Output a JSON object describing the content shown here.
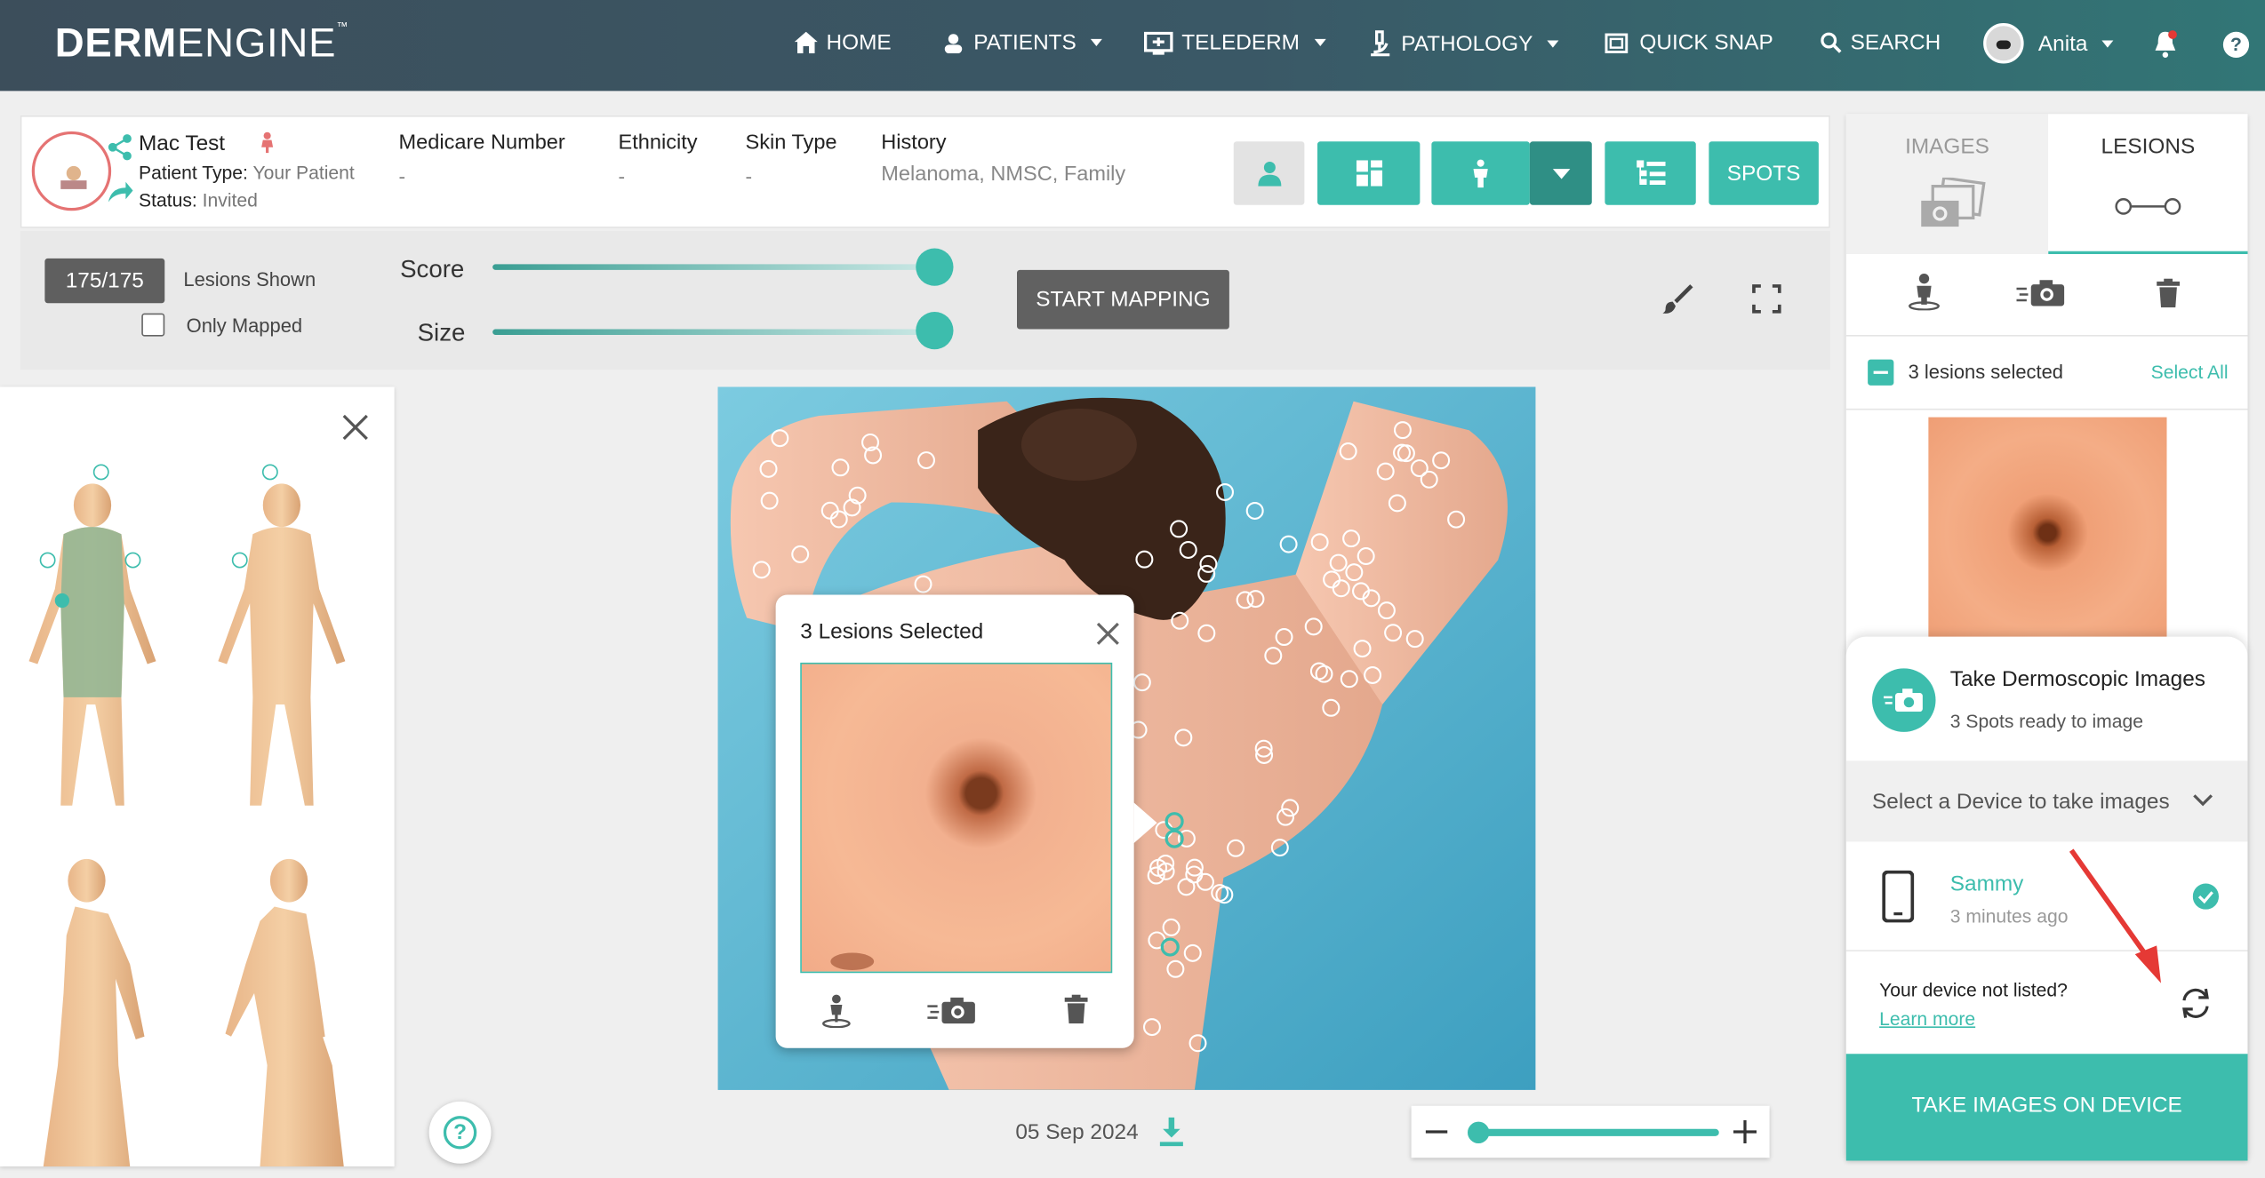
{
  "header": {
    "logo_bold": "DERM",
    "logo_light": "ENGINE",
    "logo_tm": "™",
    "nav": [
      {
        "label": "HOME",
        "icon": "home-icon",
        "caret": false
      },
      {
        "label": "PATIENTS",
        "icon": "patients-icon",
        "caret": true
      },
      {
        "label": "TELEDERM",
        "icon": "telederm-icon",
        "caret": true
      },
      {
        "label": "PATHOLOGY",
        "icon": "microscope-icon",
        "caret": true
      },
      {
        "label": "QUICK SNAP",
        "icon": "camera-icon",
        "caret": false
      },
      {
        "label": "SEARCH",
        "icon": "search-icon",
        "caret": false
      }
    ],
    "user": "Anita"
  },
  "patient": {
    "name": "Mac Test",
    "type_label": "Patient Type:",
    "type_value": "Your Patient",
    "status_label": "Status:",
    "status_value": "Invited",
    "fields": [
      {
        "label": "Medicare Number",
        "value": "-"
      },
      {
        "label": "Ethnicity",
        "value": "-"
      },
      {
        "label": "Skin Type",
        "value": "-"
      },
      {
        "label": "History",
        "value": "Melanoma, NMSC, Family"
      }
    ],
    "spots_label": "SPOTS"
  },
  "controls": {
    "count": "175/175",
    "lesions_shown": "Lesions Shown",
    "only_mapped": "Only Mapped",
    "score_label": "Score",
    "size_label": "Size",
    "score_value": 1.0,
    "size_value": 1.0,
    "start_mapping": "START MAPPING"
  },
  "popup": {
    "title": "3 Lesions Selected"
  },
  "footer": {
    "date": "05 Sep 2024",
    "zoom_level": 0.0
  },
  "right": {
    "tab_images": "IMAGES",
    "tab_lesions": "LESIONS",
    "selected": "3 lesions selected",
    "select_all": "Select All",
    "take_title": "Take Dermoscopic Images",
    "take_sub": "3 Spots ready to image",
    "device_select": "Select a Device to take images",
    "device_name": "Sammy",
    "device_time": "3 minutes ago",
    "not_listed": "Your device not listed?",
    "learn_more": "Learn more",
    "take_btn": "TAKE IMAGES ON DEVICE"
  },
  "colors": {
    "accent": "#3dbdad",
    "header": "#3a5866",
    "annotation_arrow": "#e53935"
  }
}
